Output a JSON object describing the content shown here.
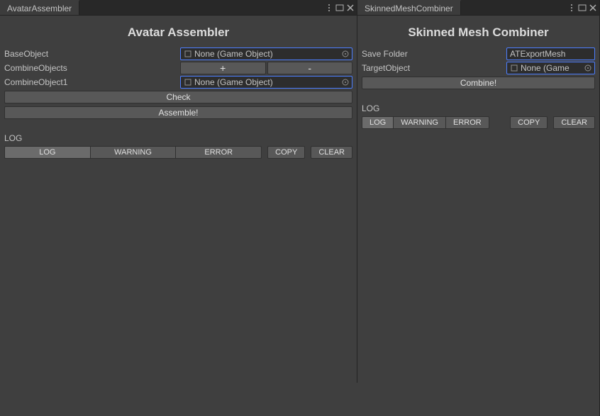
{
  "left": {
    "tab": "AvatarAssembler",
    "title": "Avatar Assembler",
    "fields": {
      "baseObject": {
        "label": "BaseObject",
        "value": "None (Game Object)"
      },
      "combineObjects": {
        "label": "CombineObjects"
      },
      "combineObject1": {
        "label": "CombineObject1",
        "value": "None (Game Object)"
      }
    },
    "buttons": {
      "plus": "+",
      "minus": "-",
      "check": "Check",
      "assemble": "Assemble!"
    },
    "log": {
      "label": "LOG",
      "tabs": {
        "log": "LOG",
        "warning": "WARNING",
        "error": "ERROR"
      },
      "copy": "COPY",
      "clear": "CLEAR"
    }
  },
  "right": {
    "tab": "SkinnedMeshCombiner",
    "title": "Skinned Mesh Combiner",
    "fields": {
      "saveFolder": {
        "label": "Save Folder",
        "value": "ATExportMesh"
      },
      "targetObject": {
        "label": "TargetObject",
        "value": "None (Game"
      }
    },
    "buttons": {
      "combine": "Combine!"
    },
    "log": {
      "label": "LOG",
      "tabs": {
        "log": "LOG",
        "warning": "WARNING",
        "error": "ERROR"
      },
      "copy": "COPY",
      "clear": "CLEAR"
    }
  },
  "icons": {
    "gameobject": "cube-icon",
    "picker": "target-icon",
    "menu": "kebab-icon",
    "pop": "popout-icon",
    "close": "close-icon"
  }
}
